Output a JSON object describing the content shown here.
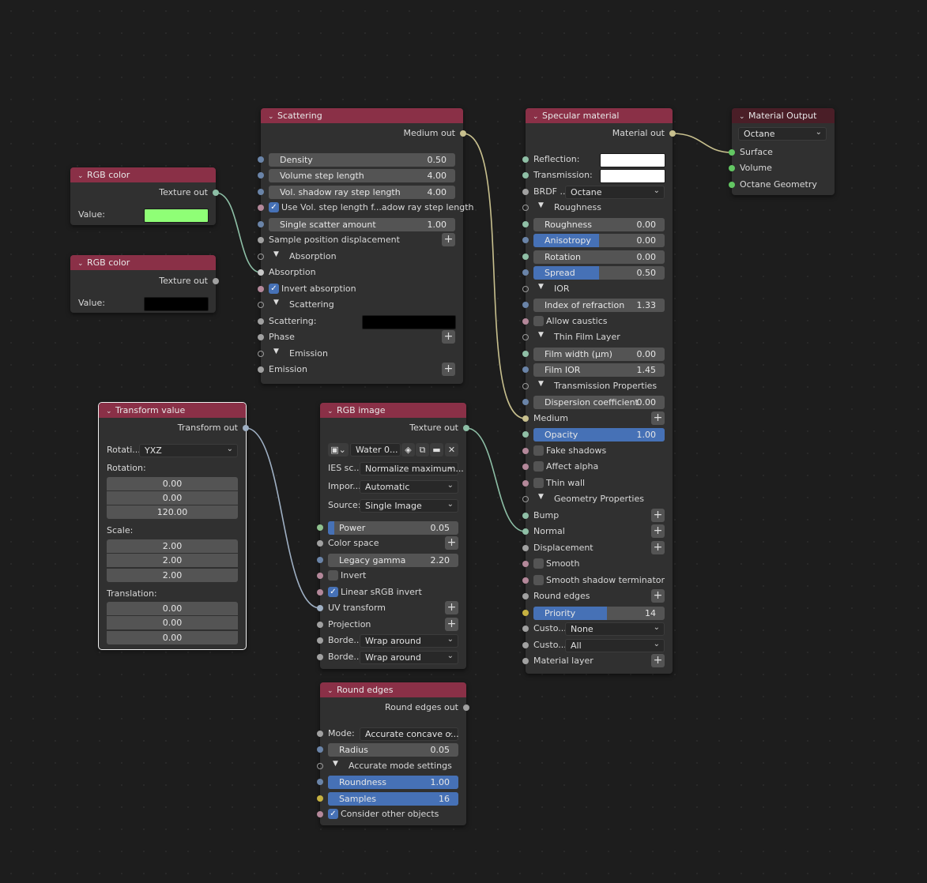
{
  "colors": {
    "header": "#8a3047",
    "header_output": "#4a1e27",
    "accent": "#4671b6",
    "rgb_color_1": "#8fff76",
    "rgb_color_2": "#000000",
    "white": "#ffffff"
  },
  "rgb1": {
    "title": "RGB color",
    "out": "Texture out",
    "value_label": "Value:"
  },
  "rgb2": {
    "title": "RGB color",
    "out": "Texture out",
    "value_label": "Value:"
  },
  "scattering": {
    "title": "Scattering",
    "out": "Medium out",
    "density": {
      "label": "Density",
      "value": "0.50"
    },
    "vol_step": {
      "label": "Volume step length",
      "value": "4.00"
    },
    "vol_shadow": {
      "label": "Vol. shadow ray step length",
      "value": "4.00"
    },
    "use_vol": "Use Vol. step length f...adow ray step length",
    "single_scatter": {
      "label": "Single scatter amount",
      "value": "1.00"
    },
    "sample_pos": "Sample position displacement",
    "absorption_section": "Absorption",
    "absorption": "Absorption",
    "invert_absorption": "Invert absorption",
    "scattering_section": "Scattering",
    "scattering_label": "Scattering:",
    "phase": "Phase",
    "emission_section": "Emission",
    "emission": "Emission"
  },
  "transform": {
    "title": "Transform value",
    "out": "Transform out",
    "rotation_order_label": "Rotati...",
    "rotation_order": "YXZ",
    "rotation_label": "Rotation:",
    "rotation": [
      "0.00",
      "0.00",
      "120.00"
    ],
    "scale_label": "Scale:",
    "scale": [
      "2.00",
      "2.00",
      "2.00"
    ],
    "translation_label": "Translation:",
    "translation": [
      "0.00",
      "0.00",
      "0.00"
    ]
  },
  "rgbimage": {
    "title": "RGB image",
    "out": "Texture out",
    "image_name": "Water 0...",
    "ies_label": "IES sc...",
    "ies_value": "Normalize maximum...",
    "import_label": "Impor...",
    "import_value": "Automatic",
    "source_label": "Source:",
    "source_value": "Single Image",
    "power": {
      "label": "Power",
      "value": "0.05",
      "fill": 0.05
    },
    "color_space": "Color space",
    "legacy_gamma": {
      "label": "Legacy gamma",
      "value": "2.20"
    },
    "invert": "Invert",
    "linear_srgb": "Linear sRGB invert",
    "uv_transform": "UV transform",
    "projection": "Projection",
    "border1_label": "Borde...",
    "border1_value": "Wrap around",
    "border2_label": "Borde...",
    "border2_value": "Wrap around"
  },
  "round": {
    "title": "Round edges",
    "out": "Round edges out",
    "mode_label": "Mode:",
    "mode_value": "Accurate concave o...",
    "radius": {
      "label": "Radius",
      "value": "0.05"
    },
    "accurate": "Accurate mode settings",
    "roundness": {
      "label": "Roundness",
      "value": "1.00",
      "fill": 1.0
    },
    "samples": {
      "label": "Samples",
      "value": "16",
      "fill": 1.0
    },
    "consider": "Consider other objects"
  },
  "specular": {
    "title": "Specular material",
    "out": "Material out",
    "reflection": "Reflection:",
    "transmission": "Transmission:",
    "brdf_label": "BRDF ...",
    "brdf_value": "Octane",
    "roughness_section": "Roughness",
    "roughness": {
      "label": "Roughness",
      "value": "0.00"
    },
    "anisotropy": {
      "label": "Anisotropy",
      "value": "0.00",
      "fill": 0.5
    },
    "rotation": {
      "label": "Rotation",
      "value": "0.00"
    },
    "spread": {
      "label": "Spread",
      "value": "0.50",
      "fill": 0.5
    },
    "ior_section": "IOR",
    "ior": {
      "label": "Index of refraction",
      "value": "1.33"
    },
    "allow_caustics": "Allow caustics",
    "thin_film_section": "Thin Film Layer",
    "film_width": {
      "label": "Film width (µm)",
      "value": "0.00"
    },
    "film_ior": {
      "label": "Film IOR",
      "value": "1.45"
    },
    "transmission_props": "Transmission Properties",
    "dispersion": {
      "label": "Dispersion coefficient",
      "value": "0.00"
    },
    "medium": "Medium",
    "opacity": {
      "label": "Opacity",
      "value": "1.00",
      "fill": 1.0
    },
    "fake_shadows": "Fake shadows",
    "affect_alpha": "Affect alpha",
    "thin_wall": "Thin wall",
    "geometry_props": "Geometry Properties",
    "bump": "Bump",
    "normal": "Normal",
    "displacement": "Displacement",
    "smooth": "Smooth",
    "smooth_shadow": "Smooth shadow terminator",
    "round_edges": "Round edges",
    "priority": {
      "label": "Priority",
      "value": "14",
      "fill": 0.56
    },
    "custom1_label": "Custo...",
    "custom1_value": "None",
    "custom2_label": "Custo...",
    "custom2_value": "All",
    "material_layer": "Material layer"
  },
  "output": {
    "title": "Material Output",
    "renderer": "Octane",
    "surface": "Surface",
    "volume": "Volume",
    "geometry": "Octane Geometry"
  }
}
